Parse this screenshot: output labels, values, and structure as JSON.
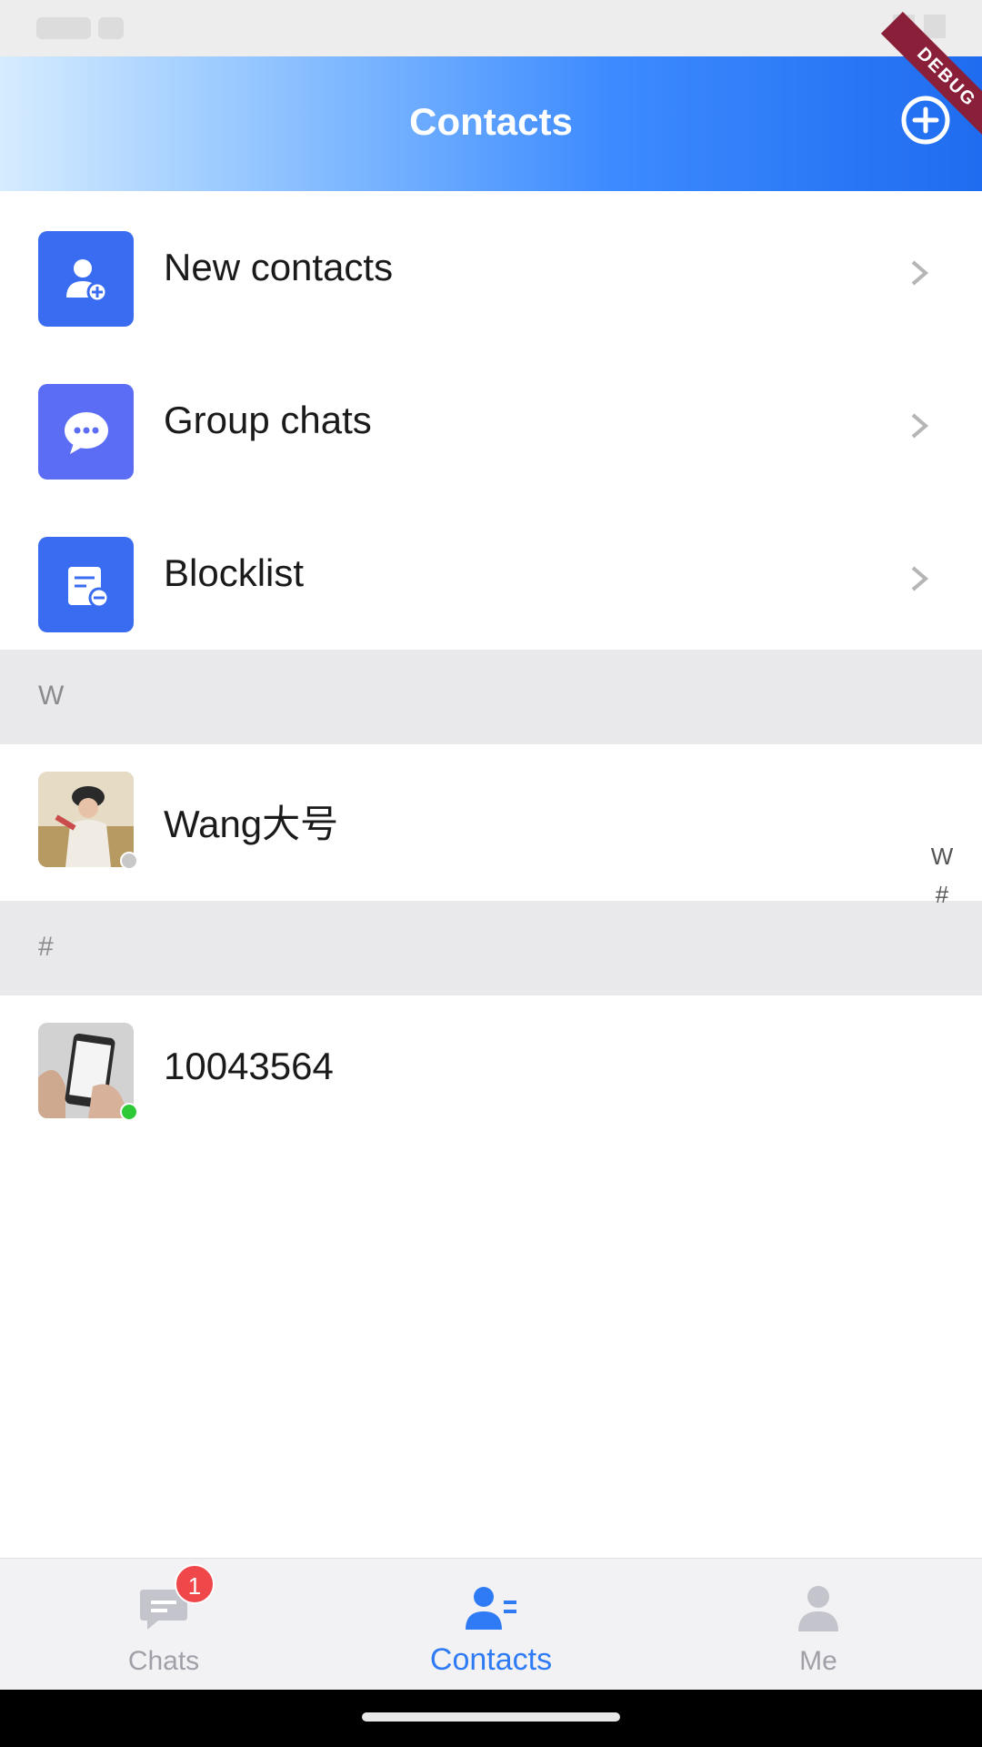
{
  "header": {
    "title": "Contacts",
    "debug_label": "DEBUG"
  },
  "menu": [
    {
      "label": "New contacts",
      "icon": "add-person-icon",
      "color": "#3a6cf2"
    },
    {
      "label": "Group chats",
      "icon": "chat-bubble-icon",
      "color": "#5b6cf5"
    },
    {
      "label": "Blocklist",
      "icon": "blocklist-icon",
      "color": "#3a6cf2"
    }
  ],
  "sections": [
    {
      "letter": "W",
      "contacts": [
        {
          "name": "Wang大号",
          "status": "offline",
          "status_color": "#c8c8c8"
        }
      ]
    },
    {
      "letter": "#",
      "contacts": [
        {
          "name": "10043564",
          "status": "online",
          "status_color": "#2ec937"
        }
      ]
    }
  ],
  "index_bar": [
    "W",
    "#"
  ],
  "bottom_nav": [
    {
      "label": "Chats",
      "icon": "chats-icon",
      "badge": "1",
      "active": false
    },
    {
      "label": "Contacts",
      "icon": "contacts-icon",
      "active": true
    },
    {
      "label": "Me",
      "icon": "me-icon",
      "active": false
    }
  ],
  "colors": {
    "accent": "#2f7bf5",
    "badge": "#f0474b"
  }
}
